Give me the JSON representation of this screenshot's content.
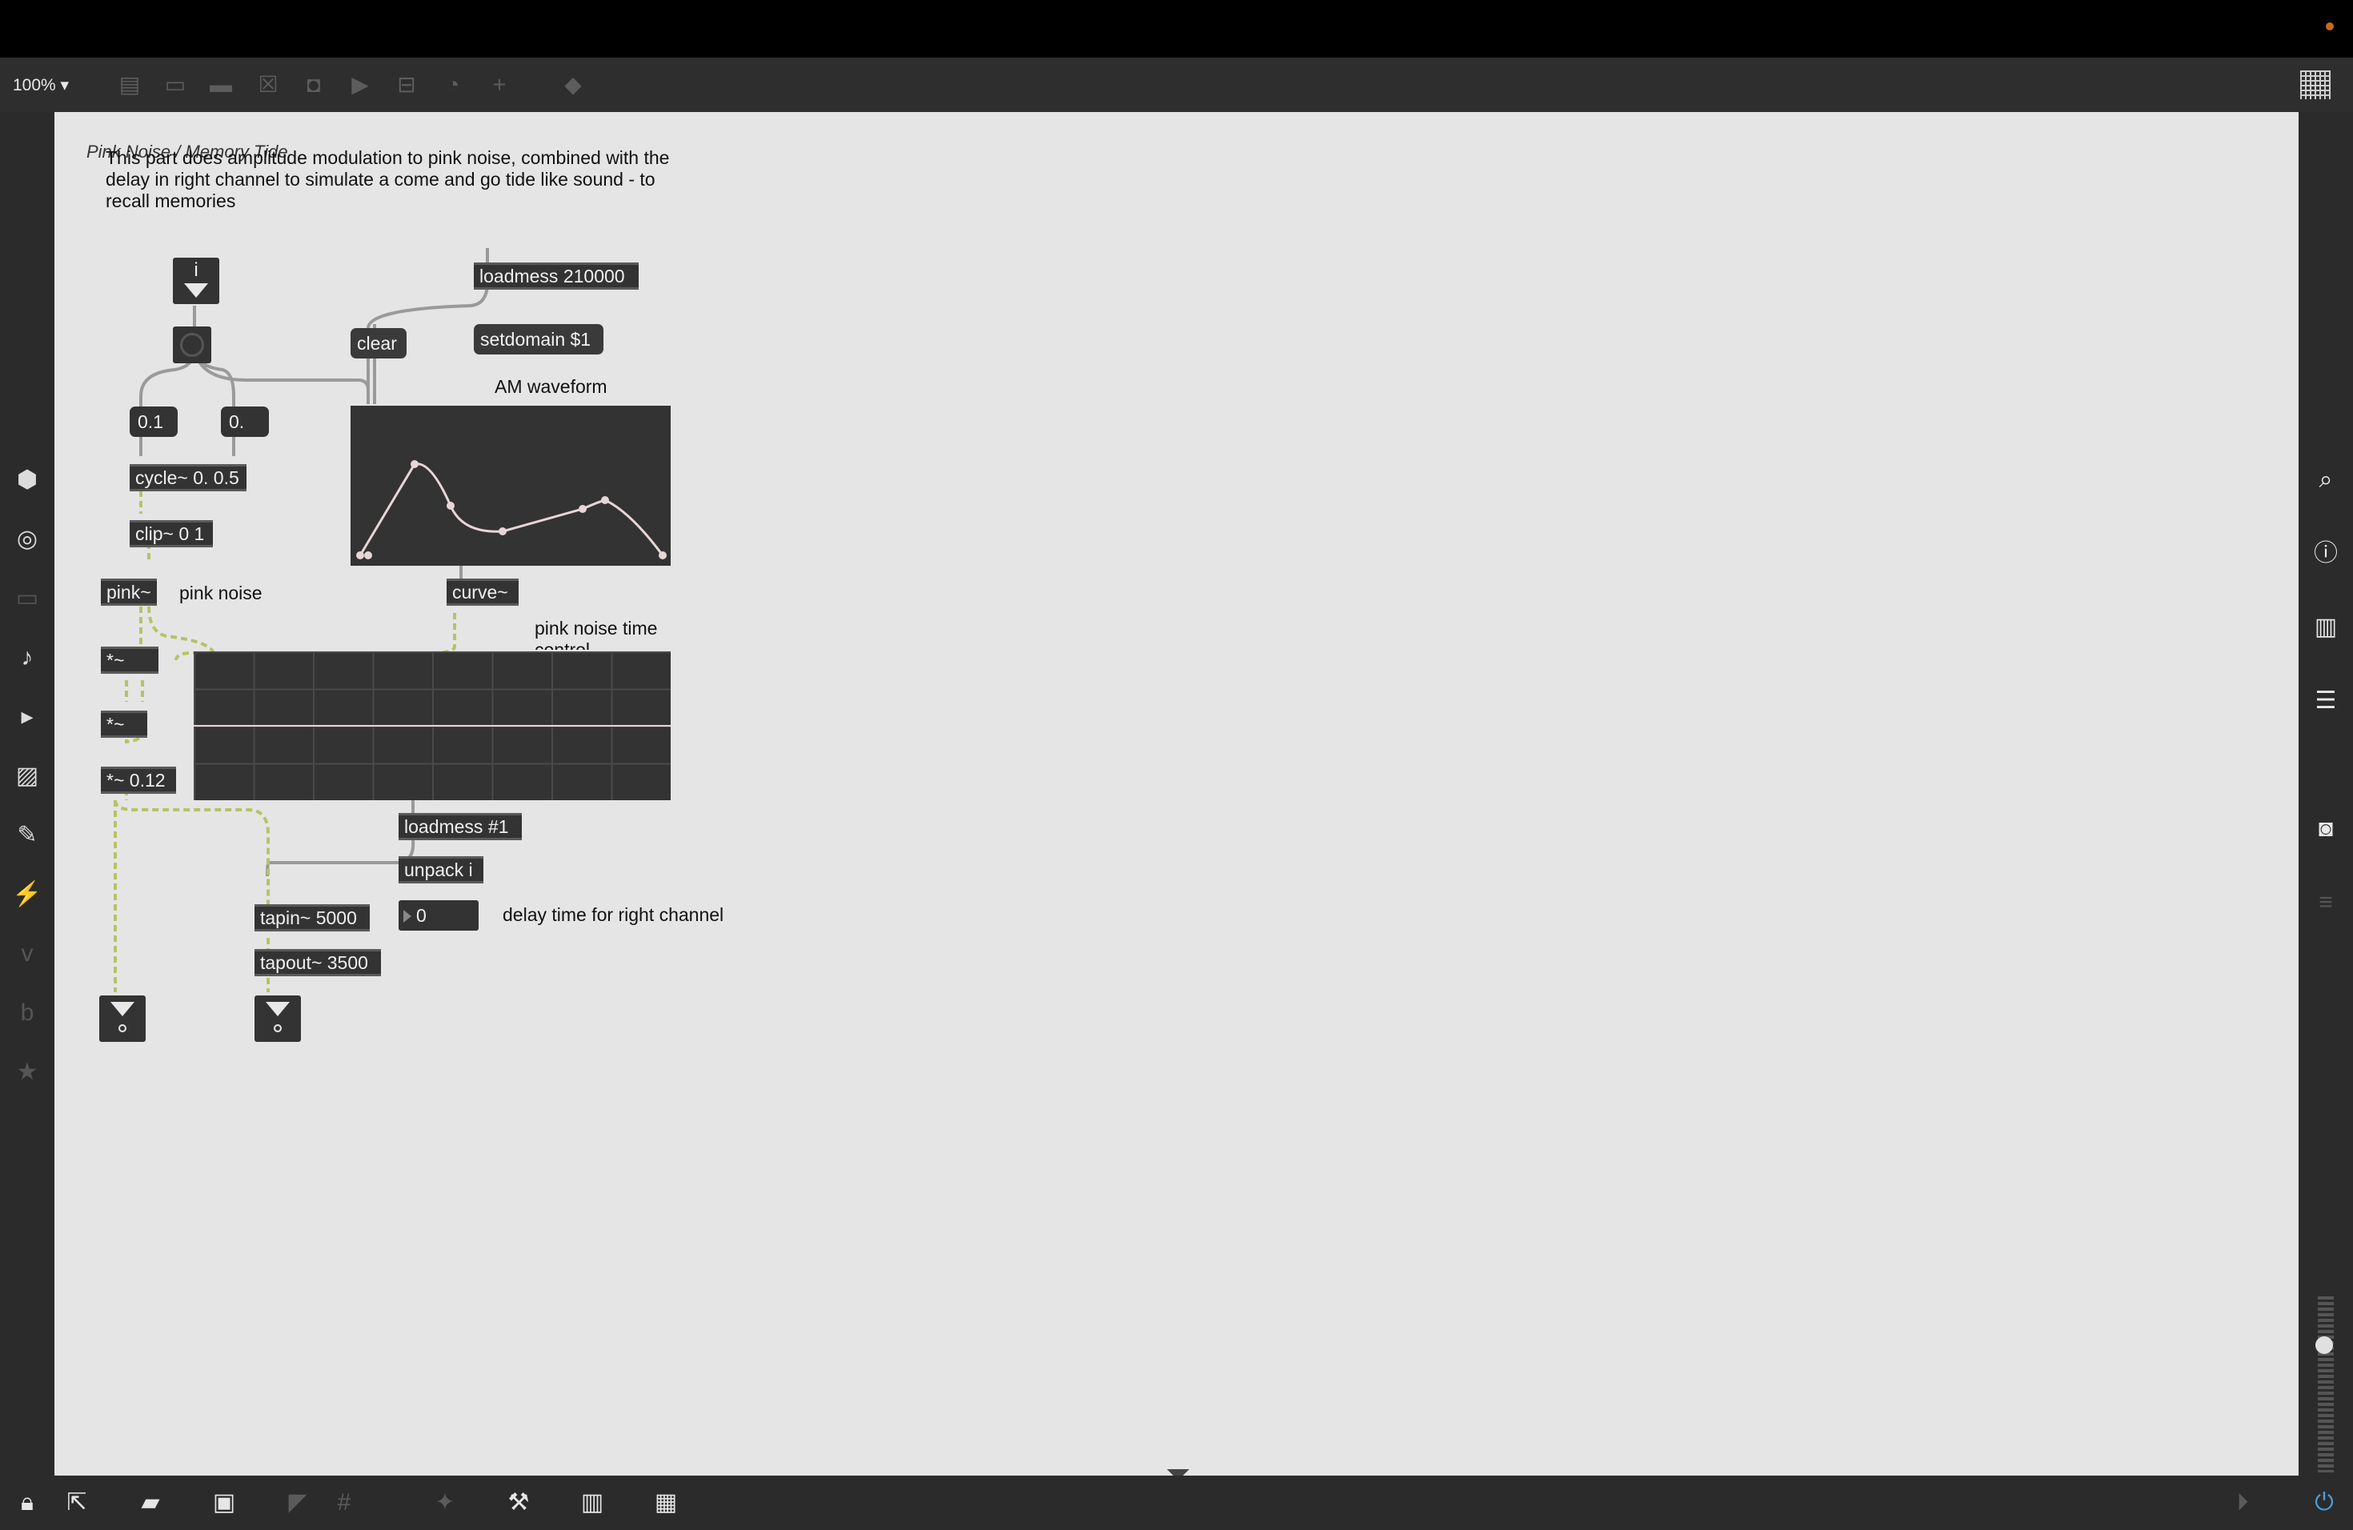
{
  "toolbar": {
    "zoom_label": "100%"
  },
  "canvas": {
    "title": "Pink Noise / Memory Tide",
    "comment_intro": "This part does amplitude modulation to pink noise, combined with the delay in right channel to simulate a come and go tide like sound - to recall memories",
    "comment_am_waveform": "AM waveform",
    "comment_pink_noise": "pink noise",
    "comment_pink_noise_time": "pink noise time control",
    "comment_delay_time": "delay time for right channel",
    "objects": {
      "inlet_label": "i",
      "loadmess_210000": "loadmess 210000",
      "setdomain": "setdomain $1",
      "clear": "clear",
      "num_01": "0.1",
      "num_0": "0.",
      "cycle": "cycle~ 0. 0.5",
      "clip": "clip~ 0 1",
      "pink": "pink~",
      "curve": "curve~",
      "mul_1": "*~",
      "mul_2": "*~",
      "mul_3": "*~ 0.12",
      "loadmess_1": "loadmess #1",
      "unpack": "unpack i",
      "delay_num": "0",
      "tapin": "tapin~ 5000",
      "tapout": "tapout~ 3500"
    }
  },
  "colors": {
    "canvas_bg": "#e5e5e5",
    "object_bg": "#333333",
    "audio_cord": "#b8c267",
    "control_cord": "#9a9a9a"
  }
}
